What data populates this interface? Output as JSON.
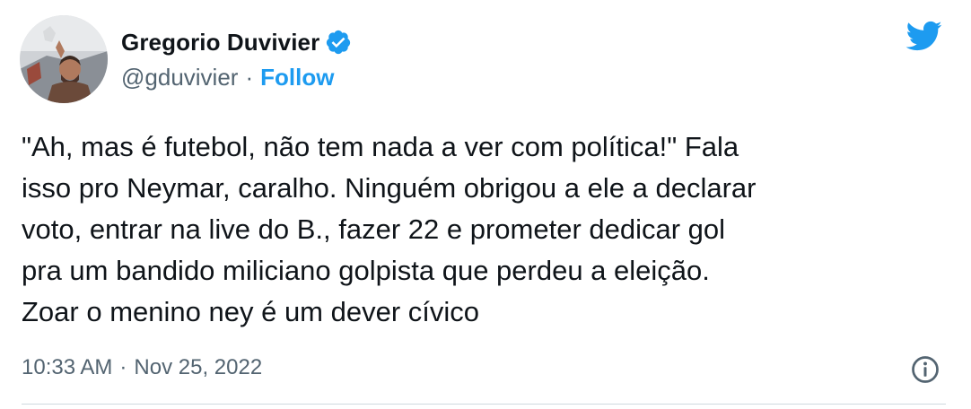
{
  "author": {
    "name": "Gregorio Duvivier",
    "handle": "@gduvivier",
    "separator": "·",
    "follow_label": "Follow",
    "verified_icon": "verified-badge-icon",
    "avatar_icon": "avatar"
  },
  "tweet": {
    "text": "\"Ah, mas é futebol, não tem nada a ver com política!\" Fala\nisso pro Neymar, caralho. Ninguém obrigou a ele a declarar\nvoto, entrar na live do B., fazer 22 e prometer dedicar gol\npra um bandido miliciano golpista que perdeu a eleição.\nZoar o menino ney é um dever cívico",
    "time": "10:33 AM",
    "separator": "·",
    "date": "Nov 25, 2022"
  },
  "icons": {
    "logo": "twitter-bird-icon",
    "info": "info-icon"
  },
  "colors": {
    "accent": "#1d9bf0",
    "secondary_text": "#536471",
    "primary_text": "#0f1419",
    "divider": "#cfd9de"
  }
}
